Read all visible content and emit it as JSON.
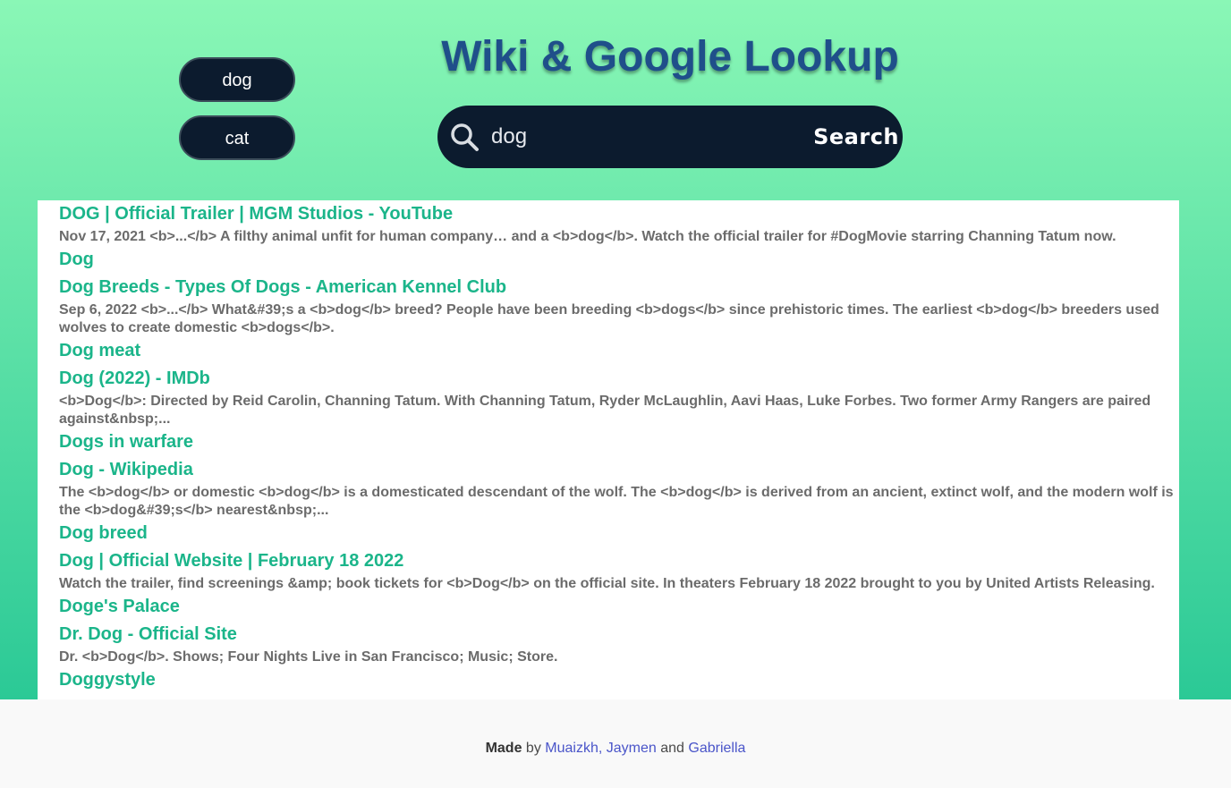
{
  "header": {
    "title": "Wiki & Google Lookup"
  },
  "history": {
    "items": [
      {
        "label": "dog"
      },
      {
        "label": "cat"
      }
    ]
  },
  "search": {
    "value": "dog",
    "button_label": "Search"
  },
  "results": [
    {
      "title": "DOG | Official Trailer | MGM Studios - YouTube",
      "snippet": "Nov 17, 2021 <b>...</b> A filthy animal unfit for human company… and a <b>dog</b>. Watch the official trailer for #DogMovie starring Channing Tatum now."
    },
    {
      "title": "Dog",
      "snippet": ""
    },
    {
      "title": "Dog Breeds - Types Of Dogs - American Kennel Club",
      "snippet": "Sep 6, 2022 <b>...</b> What&#39;s a <b>dog</b> breed? People have been breeding <b>dogs</b> since prehistoric times. The earliest <b>dog</b> breeders used wolves to create domestic <b>dogs</b>."
    },
    {
      "title": "Dog meat",
      "snippet": ""
    },
    {
      "title": "Dog (2022) - IMDb",
      "snippet": "<b>Dog</b>: Directed by Reid Carolin, Channing Tatum. With Channing Tatum, Ryder McLaughlin, Aavi Haas, Luke Forbes. Two former Army Rangers are paired against&nbsp;..."
    },
    {
      "title": "Dogs in warfare",
      "snippet": ""
    },
    {
      "title": "Dog - Wikipedia",
      "snippet": "The <b>dog</b> or domestic <b>dog</b> is a domesticated descendant of the wolf. The <b>dog</b> is derived from an ancient, extinct wolf, and the modern wolf is the <b>dog&#39;s</b> nearest&nbsp;..."
    },
    {
      "title": "Dog breed",
      "snippet": ""
    },
    {
      "title": "Dog | Official Website | February 18 2022",
      "snippet": "Watch the trailer, find screenings &amp; book tickets for <b>Dog</b> on the official site. In theaters February 18 2022 brought to you by United Artists Releasing."
    },
    {
      "title": "Doge's Palace",
      "snippet": ""
    },
    {
      "title": "Dr. Dog - Official Site",
      "snippet": "Dr. <b>Dog</b>. Shows; Four Nights Live in San Francisco; Music; Store."
    },
    {
      "title": "Doggystyle",
      "snippet": ""
    }
  ],
  "footer": {
    "made": "Made",
    "by": " by ",
    "authors_link": "Muaizkh, Jaymen",
    "and": " and ",
    "last_author_link": "Gabriella"
  },
  "colors": {
    "gradient_top": "#8af7b6",
    "gradient_bottom": "#2bc996",
    "dark_navy": "#0c1b2e",
    "title_blue": "#1f4f8a",
    "result_title_green": "#1bb58a",
    "link_blue": "#4a55c9"
  },
  "icons": {
    "search": "magnifier"
  }
}
